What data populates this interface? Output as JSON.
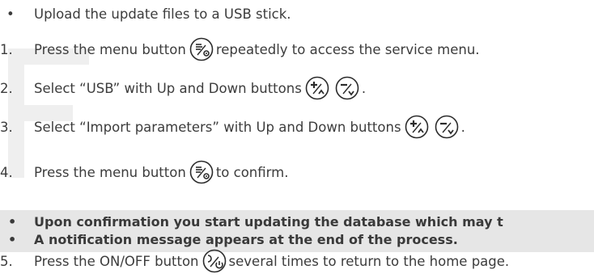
{
  "steps": [
    {
      "marker": "•",
      "parts": [
        "Upload the update files to a USB stick."
      ]
    },
    {
      "marker": "1.",
      "parts": [
        "Press the menu button ",
        "",
        " repeatedly to access the service menu."
      ],
      "icons": [
        "menu-icon"
      ]
    },
    {
      "marker": "2.",
      "parts": [
        "Select “USB” with Up and Down buttons ",
        "",
        "",
        "."
      ],
      "icons": [
        "up-icon",
        "down-icon"
      ]
    },
    {
      "marker": "3.",
      "parts": [
        "Select “Import parameters” with Up and Down buttons ",
        "",
        "",
        "."
      ],
      "icons": [
        "up-icon",
        "down-icon"
      ]
    },
    {
      "marker": "4.",
      "parts": [
        "Press the menu button ",
        "",
        " to confirm."
      ],
      "icons": [
        "menu-icon"
      ]
    },
    {
      "marker": "5.",
      "parts": [
        "Press the ON/OFF button ",
        "",
        " several times to return to the home page."
      ],
      "icons": [
        "power-icon"
      ]
    }
  ],
  "note": {
    "items": [
      {
        "marker": "•",
        "text": "Upon confirmation you start updating the database which may t"
      },
      {
        "marker": "•",
        "text": "A notification message appears at the end of the process."
      }
    ],
    "background": "#e6e6e6"
  },
  "colors": {
    "text": "#3c3c3c",
    "icon_stroke": "#2b2b2b"
  }
}
